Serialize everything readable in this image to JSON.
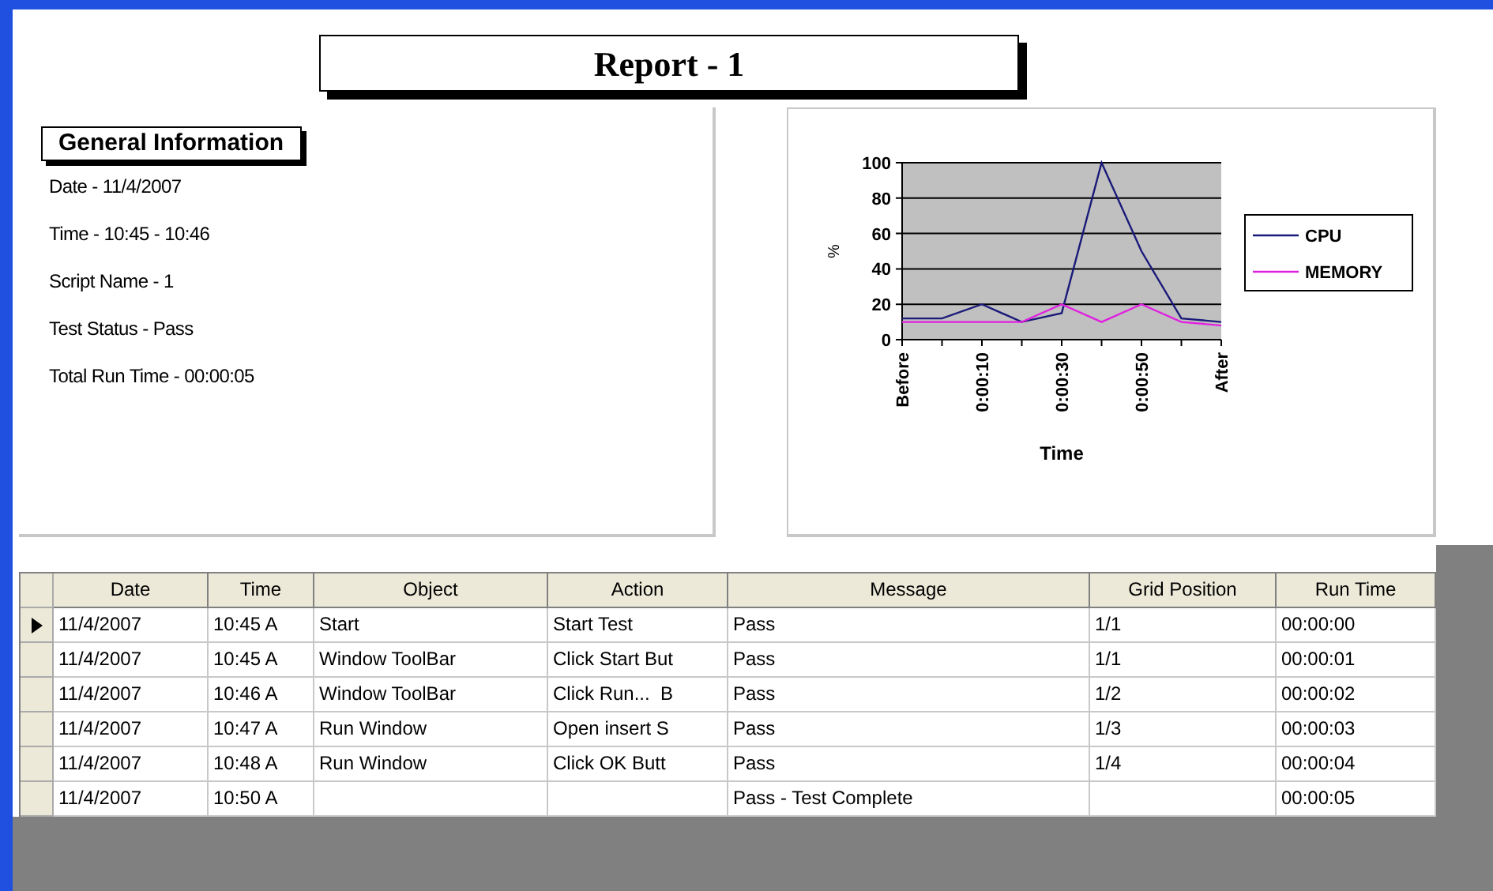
{
  "report": {
    "title": "Report - 1"
  },
  "general_info": {
    "heading": "General Information",
    "lines": [
      "Date - 11/4/2007",
      "Time - 10:45 - 10:46",
      "Script Name - 1",
      "Test Status - Pass",
      "Total Run Time - 00:00:05"
    ]
  },
  "chart": {
    "chart_data": {
      "type": "line",
      "xlabel": "Time",
      "ylabel": "%",
      "categories": [
        "Before",
        null,
        "0:00:10",
        null,
        "0:00:30",
        null,
        "0:00:50",
        null,
        "After"
      ],
      "yticks": [
        0,
        20,
        40,
        60,
        80,
        100
      ],
      "ylim": [
        0,
        100
      ],
      "grid": true,
      "legend": "right",
      "series": [
        {
          "name": "CPU",
          "color": "#1a1a7a",
          "values": [
            12,
            12,
            20,
            10,
            15,
            100,
            50,
            12,
            10
          ]
        },
        {
          "name": "MEMORY",
          "color": "#e020e0",
          "values": [
            10,
            10,
            10,
            10,
            20,
            10,
            20,
            10,
            8
          ]
        }
      ]
    }
  },
  "table": {
    "columns": [
      "Date",
      "Time",
      "Object",
      "Action",
      "Message",
      "Grid Position",
      "Run Time"
    ],
    "rows": [
      {
        "selected": true,
        "cells": [
          "11/4/2007",
          "10:45 A",
          "Start",
          "Start Test",
          "Pass",
          "1/1",
          "00:00:00"
        ]
      },
      {
        "selected": false,
        "cells": [
          "11/4/2007",
          "10:45 A",
          "Window ToolBar",
          "Click Start But",
          "Pass",
          "1/1",
          "00:00:01"
        ]
      },
      {
        "selected": false,
        "cells": [
          "11/4/2007",
          "10:46 A",
          "Window ToolBar",
          "Click Run...  B",
          "Pass",
          "1/2",
          "00:00:02"
        ]
      },
      {
        "selected": false,
        "cells": [
          "11/4/2007",
          "10:47 A",
          "Run Window",
          "Open insert S",
          "Pass",
          "1/3",
          "00:00:03"
        ]
      },
      {
        "selected": false,
        "cells": [
          "11/4/2007",
          "10:48 A",
          "Run Window",
          "Click OK Butt",
          "Pass",
          "1/4",
          "00:00:04"
        ]
      },
      {
        "selected": false,
        "cells": [
          "11/4/2007",
          "10:50 A",
          "",
          "",
          "Pass - Test Complete",
          "",
          "00:00:05"
        ]
      }
    ]
  }
}
